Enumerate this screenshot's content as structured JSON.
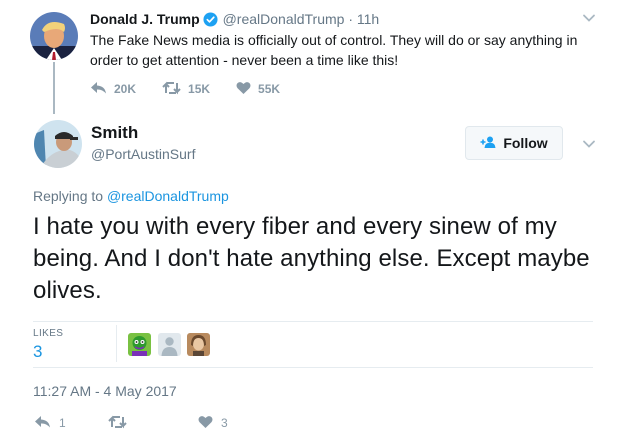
{
  "parent_tweet": {
    "name": "Donald J. Trump",
    "handle": "@realDonaldTrump",
    "separator": "·",
    "time": "11h",
    "text": "The Fake News media is officially out of control. They will do or say anything in order to get attention - never been a time like this!",
    "replies": "20K",
    "retweets": "15K",
    "likes": "55K"
  },
  "main_tweet": {
    "name": "Smith",
    "handle": "@PortAustinSurf",
    "follow_label": "Follow",
    "replying_prefix": "Replying to",
    "replying_to": "@realDonaldTrump",
    "text": "I hate you with every fiber and every sinew of my being. And I don't hate anything else. Except maybe olives.",
    "likes_label": "LIKES",
    "likes_count": "3",
    "timestamp": "11:27 AM - 4 May 2017",
    "reply_count": "1",
    "retweet_count": "",
    "like_count": "3"
  },
  "colors": {
    "accent": "#1b95e0",
    "muted": "#657786",
    "icon": "#8899a6",
    "text": "#14171a"
  },
  "icons": [
    "verified-badge-icon",
    "chevron-down-icon",
    "reply-icon",
    "retweet-icon",
    "heart-icon",
    "add-user-icon"
  ]
}
